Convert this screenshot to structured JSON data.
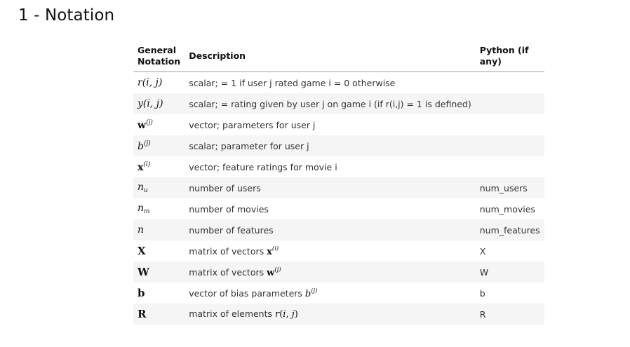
{
  "heading": "1 - Notation",
  "table": {
    "headers": {
      "notation_line1": "General",
      "notation_line2": "Notation",
      "description": "Description",
      "python": "Python (if any)"
    },
    "rows": [
      {
        "notation": "r(i,j)",
        "description": "scalar; = 1 if user j rated game i = 0 otherwise",
        "python": ""
      },
      {
        "notation": "y(i,j)",
        "description": "scalar; = rating given by user j on game i (if r(i,j) = 1 is defined)",
        "python": ""
      },
      {
        "notation": "w(j)",
        "description": "vector; parameters for user j",
        "python": ""
      },
      {
        "notation": "b(j)",
        "description": "scalar; parameter for user j",
        "python": ""
      },
      {
        "notation": "x(i)",
        "description": "vector; feature ratings for movie i",
        "python": ""
      },
      {
        "notation": "nu",
        "description": "number of users",
        "python": "num_users"
      },
      {
        "notation": "nm",
        "description": "number of movies",
        "python": "num_movies"
      },
      {
        "notation": "n",
        "description": "number of features",
        "python": "num_features"
      },
      {
        "notation": "X",
        "description_prefix": "matrix of vectors ",
        "description_math": "x(i)",
        "python": "X"
      },
      {
        "notation": "W",
        "description_prefix": "matrix of vectors ",
        "description_math": "w(j)",
        "python": "W"
      },
      {
        "notation": "b",
        "description_prefix": "vector of bias parameters ",
        "description_math": "b(j)",
        "python": "b"
      },
      {
        "notation": "R",
        "description_prefix": "matrix of elements ",
        "description_math": "r(i,j)",
        "python": "R"
      }
    ]
  }
}
